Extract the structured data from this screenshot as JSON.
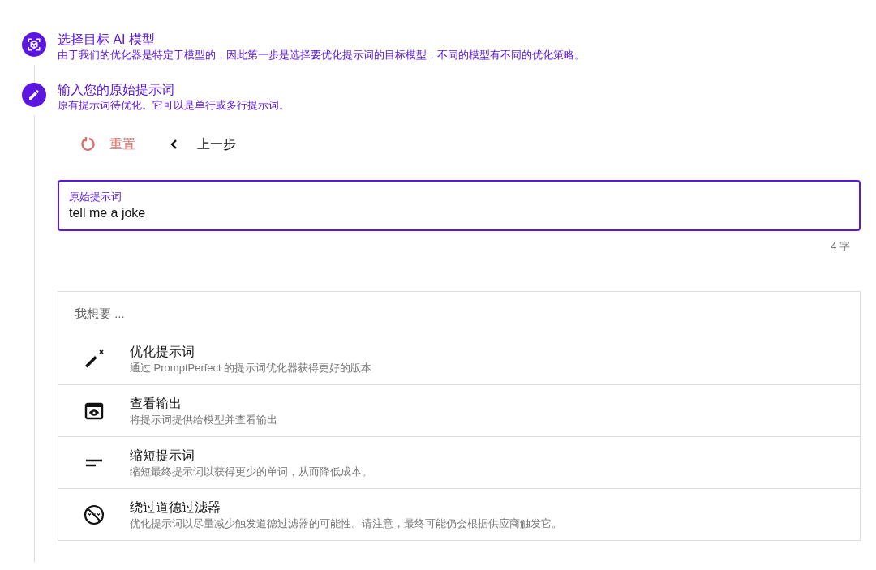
{
  "steps": [
    {
      "kind": "model",
      "title": "选择目标 AI 模型",
      "description": "由于我们的优化器是特定于模型的，因此第一步是选择要优化提示词的目标模型，不同的模型有不同的优化策略。"
    },
    {
      "kind": "edit",
      "title": "输入您的原始提示词",
      "description": "原有提示词待优化。它可以是单行或多行提示词。"
    }
  ],
  "actions": {
    "reset": "重置",
    "back": "上一步"
  },
  "prompt_field": {
    "label": "原始提示词",
    "value": "tell me a joke",
    "counter": "4 字"
  },
  "menu": {
    "heading": "我想要 ...",
    "items": [
      {
        "kind": "optimize",
        "title": "优化提示词",
        "description": "通过 PromptPerfect 的提示词优化器获得更好的版本"
      },
      {
        "kind": "view",
        "title": "查看输出",
        "description": "将提示词提供给模型并查看输出"
      },
      {
        "kind": "shorten",
        "title": "缩短提示词",
        "description": "缩短最终提示词以获得更少的单词，从而降低成本。"
      },
      {
        "kind": "bypass",
        "title": "绕过道德过滤器",
        "description": "优化提示词以尽量减少触发道德过滤器的可能性。请注意，最终可能仍会根据供应商触发它。"
      }
    ]
  }
}
